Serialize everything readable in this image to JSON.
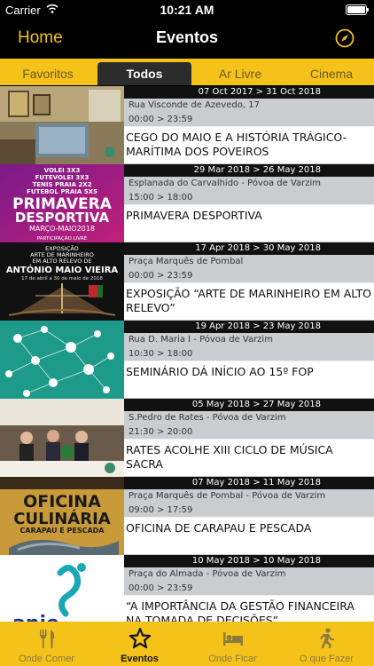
{
  "status": {
    "carrier": "Carrier",
    "time": "10:21 AM"
  },
  "nav": {
    "home": "Home",
    "title": "Eventos"
  },
  "tabs": [
    {
      "label": "Favoritos"
    },
    {
      "label": "Todos",
      "active": true
    },
    {
      "label": "Ar Livre"
    },
    {
      "label": "Cinema"
    }
  ],
  "events": [
    {
      "dates": "07 Oct 2017 > 31 Oct 2018",
      "location": "Rua Visconde de Azevedo, 17",
      "hours": "00:00 > 23:59",
      "title": "CEGO DO MAIO E A HISTÓRIA TRÁGICO-MARÍTIMA DOS POVEIROS"
    },
    {
      "dates": "29 Mar 2018 > 26 May 2018",
      "location": "Esplanada do Carvalhido - Póvoa de Varzim",
      "hours": "15:00 > 18:00",
      "title": "PRIMAVERA DESPORTIVA",
      "poster": {
        "lines": [
          "VOLEI 3X3",
          "FUTEVOLEI 3X3",
          "TENIS PRAIA 2X2",
          "FUTEBOL PRAIA 5X5"
        ],
        "big1": "PRIMAVERA",
        "big2": "DESPORTIVA",
        "sub": "MARÇO-MAIO2018",
        "foot": "PARTICIPAÇÃO LIVRE"
      }
    },
    {
      "dates": "17 Apr 2018 > 30 May 2018",
      "location": "Praça Marquês de Pombal",
      "hours": "00:00 > 23:59",
      "title": "EXPOSIÇÃO “ARTE DE MARINHEIRO EM ALTO RELEVO”",
      "poster": {
        "l1": "EXPOSIÇÃO",
        "l2": "ARTE DE MARINHEIRO",
        "l3": "EM ALTO RELEVO DE",
        "l4": "ANTÓNIO MAIO VIEIRA",
        "l5": "17 de abril a 30 de maio de 2018"
      }
    },
    {
      "dates": "19 Apr 2018 > 23 May 2018",
      "location": "Rua D. Maria I - Póvoa de Varzim",
      "hours": "10:30 > 18:00",
      "title": "SEMINÁRIO DÁ INÍCIO AO 15º FOP"
    },
    {
      "dates": "05 May 2018 > 27 May 2018",
      "location": "S.Pedro de Rates - Póvoa de Varzim",
      "hours": "21:30 > 20:00",
      "title": "RATES ACOLHE XIII CICLO DE MÚSICA SACRA"
    },
    {
      "dates": "07 May 2018 > 11 May 2018",
      "location": "Praça Marquês de Pombal - Póvoa de Varzim",
      "hours": "09:00 > 17:59",
      "title": "OFICINA DE CARAPAU E PESCADA",
      "poster": {
        "l1": "OFICINA",
        "l2": "CULINÁRIA",
        "l3": "CARAPAU E PESCADA"
      }
    },
    {
      "dates": "10 May 2018 > 10 May 2018",
      "location": "Praça do Almada - Póvoa de Varzim",
      "hours": "00:00 > 23:59",
      "title": "“A IMPORTÂNCIA DA GESTÃO FINANCEIRA NA TOMADA DE DECISÕES”",
      "poster": {
        "brand": "anje"
      }
    }
  ],
  "tabbar": [
    {
      "label": "Onde Comer",
      "icon": "cutlery-icon"
    },
    {
      "label": "Eventos",
      "icon": "star-icon",
      "active": true
    },
    {
      "label": "Onde Ficar",
      "icon": "bed-icon"
    },
    {
      "label": "O que Fazer",
      "icon": "running-icon"
    }
  ],
  "colors": {
    "accent": "#f5c21a",
    "home": "#f2c21b"
  }
}
